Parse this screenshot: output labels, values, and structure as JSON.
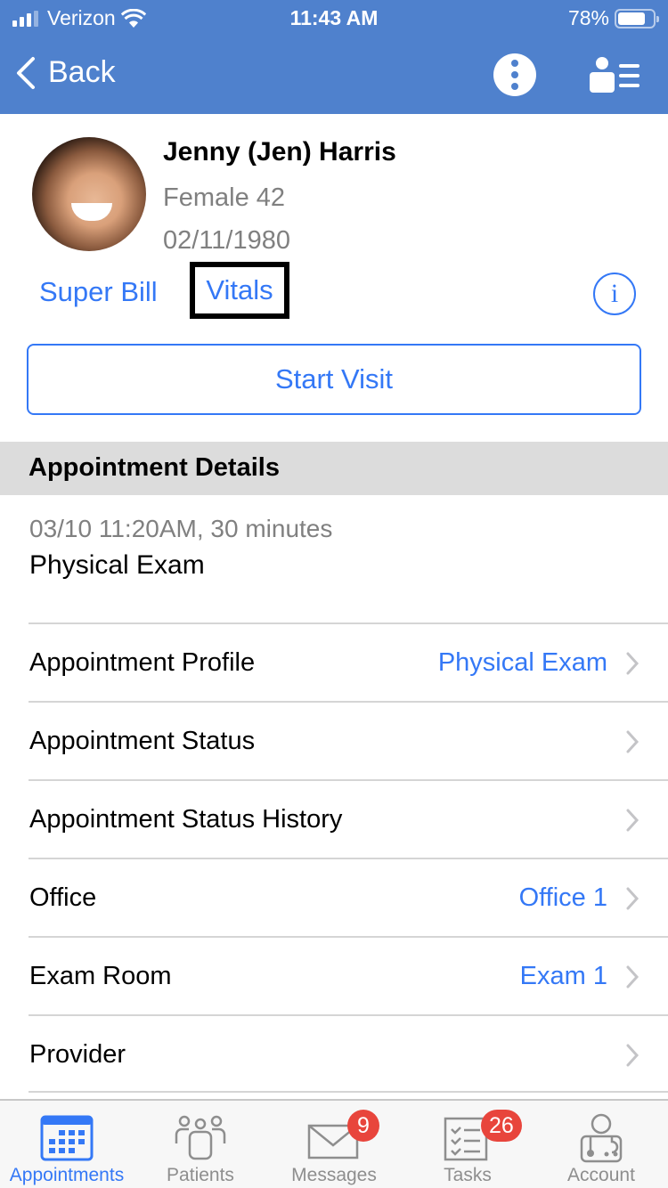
{
  "status_bar": {
    "carrier": "Verizon",
    "time": "11:43 AM",
    "battery_percent_label": "78%",
    "battery_level": 0.78,
    "signal_bars_active": 3,
    "signal_bars_total": 4
  },
  "nav": {
    "back_label": "Back",
    "more_icon": "more-vertical-icon",
    "profile_list_icon": "person-list-icon"
  },
  "patient": {
    "name": "Jenny (Jen) Harris",
    "sex_age": "Female 42",
    "dob": "02/11/1980",
    "links": {
      "super_bill": "Super Bill",
      "vitals": "Vitals"
    },
    "info_glyph": "i",
    "start_visit_label": "Start Visit"
  },
  "appointment": {
    "section_title": "Appointment Details",
    "time_summary": "03/10 11:20AM, 30 minutes",
    "type": "Physical Exam",
    "rows": [
      {
        "label": "Appointment Profile",
        "value": "Physical Exam"
      },
      {
        "label": "Appointment Status",
        "value": ""
      },
      {
        "label": "Appointment Status History",
        "value": ""
      },
      {
        "label": "Office",
        "value": "Office 1"
      },
      {
        "label": "Exam Room",
        "value": "Exam 1"
      },
      {
        "label": "Provider",
        "value": ""
      }
    ]
  },
  "tabbar": {
    "tabs": [
      {
        "label": "Appointments",
        "icon": "calendar-icon",
        "active": true,
        "badge": null
      },
      {
        "label": "Patients",
        "icon": "patients-icon",
        "active": false,
        "badge": null
      },
      {
        "label": "Messages",
        "icon": "envelope-icon",
        "active": false,
        "badge": "9"
      },
      {
        "label": "Tasks",
        "icon": "checklist-icon",
        "active": false,
        "badge": "26"
      },
      {
        "label": "Account",
        "icon": "doctor-icon",
        "active": false,
        "badge": null
      }
    ]
  },
  "colors": {
    "header_bg": "#4f81cd",
    "accent": "#3478f6",
    "badge": "#e8453c",
    "section_bg": "#dcdcdc",
    "secondary_text": "#808080"
  }
}
